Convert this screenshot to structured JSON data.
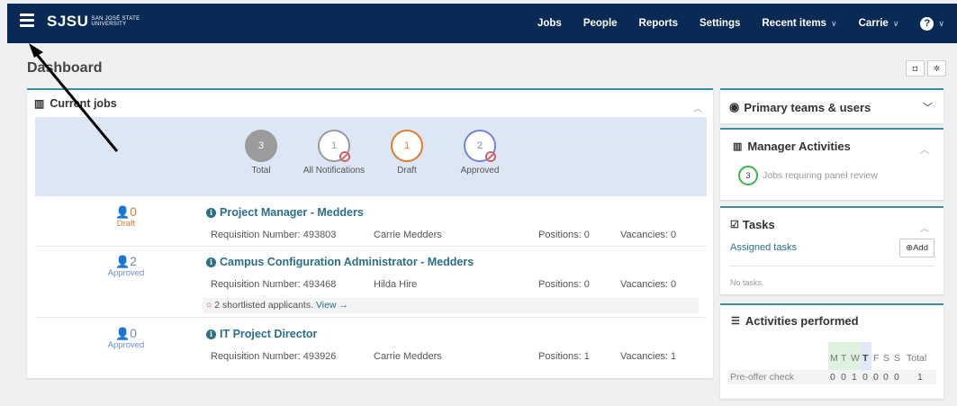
{
  "brand": {
    "name": "SJSU",
    "subtitle_line1": "San José State",
    "subtitle_line2": "University"
  },
  "nav": {
    "items": [
      "Jobs",
      "People",
      "Reports",
      "Settings"
    ],
    "recent": "Recent items",
    "user": "Carrie",
    "help": "?",
    "caret": "∨"
  },
  "page": {
    "title": "Dashboard"
  },
  "current_jobs": {
    "title": "Current jobs",
    "stats": [
      {
        "value": "3",
        "label": "Total"
      },
      {
        "value": "1",
        "label": "All Notifications"
      },
      {
        "value": "1",
        "label": "Draft"
      },
      {
        "value": "2",
        "label": "Approved"
      }
    ],
    "jobs": [
      {
        "count": "0",
        "status": "Draft",
        "title": "Project Manager - Medders",
        "req": "Requisition Number: 493803",
        "owner": "Carrie Medders",
        "positions": "Positions: 0",
        "vacancies": "Vacancies: 0"
      },
      {
        "count": "2",
        "status": "Approved",
        "title": "Campus Configuration Administrator - Medders",
        "req": "Requisition Number: 493468",
        "owner": "Hilda Hire",
        "positions": "Positions: 0",
        "vacancies": "Vacancies: 0",
        "note": "2 shortlisted applicants.",
        "note_link": "View →"
      },
      {
        "count": "0",
        "status": "Approved",
        "title": "IT Project Director",
        "req": "Requisition Number: 493926",
        "owner": "Carrie Medders",
        "positions": "Positions: 1",
        "vacancies": "Vacancies: 1"
      }
    ]
  },
  "primary_teams": {
    "title": "Primary teams & users"
  },
  "manager": {
    "title": "Manager Activities",
    "count": "3",
    "text": "Jobs requiring panel review"
  },
  "tasks": {
    "title": "Tasks",
    "assigned": "Assigned tasks",
    "add": "Add",
    "empty": "No tasks."
  },
  "activities": {
    "title": "Activities performed",
    "days": [
      "M",
      "T",
      "W",
      "T",
      "F",
      "S",
      "S"
    ],
    "total_label": "Total",
    "rows": [
      {
        "name": "Pre-offer check",
        "values": [
          "0",
          "0",
          "1",
          "0",
          "0",
          "0",
          "0"
        ],
        "total": "1"
      }
    ]
  },
  "colors": {
    "nav_bg": "#0a2a56",
    "accent": "#3f8ea6",
    "link": "#2a6f8a",
    "draft": "#e07b2a",
    "approved": "#6f86d6",
    "total": "#9b9b9b"
  }
}
